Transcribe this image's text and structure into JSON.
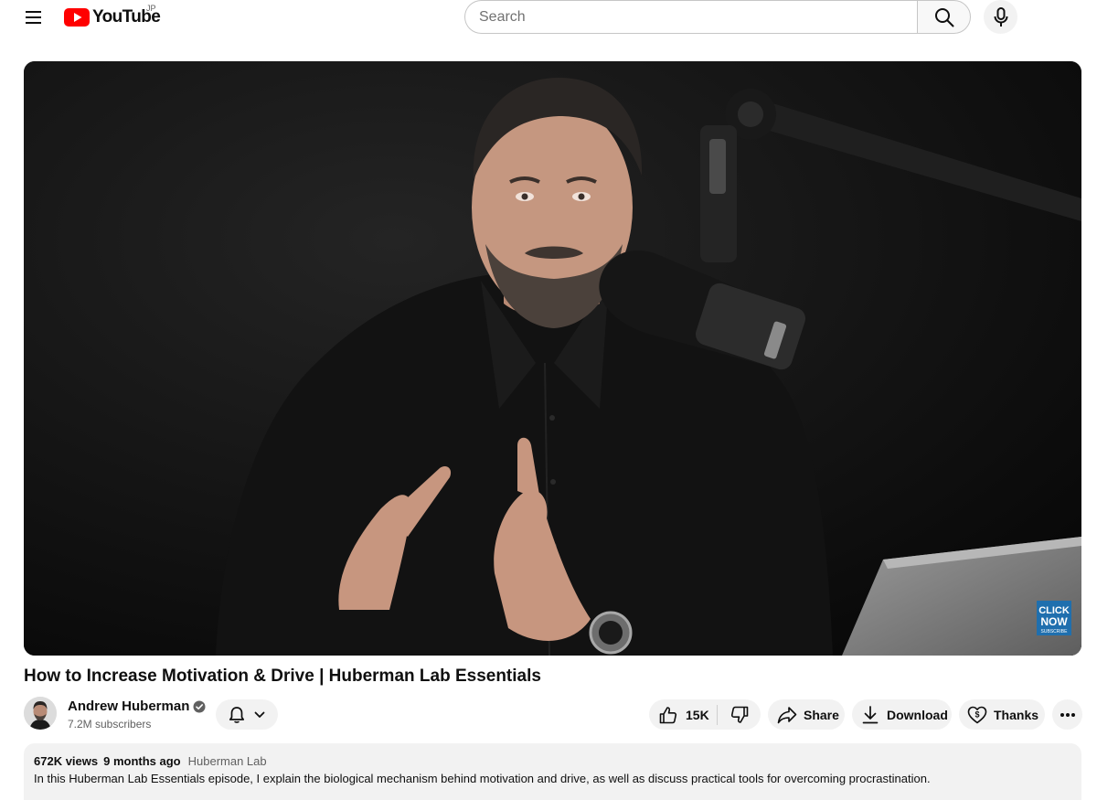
{
  "masthead": {
    "logo_text": "YouTube",
    "country_code": "JP",
    "search_placeholder": "Search",
    "icons": {
      "menu": "hamburger-icon",
      "search": "magnifier-icon",
      "voice": "microphone-icon"
    }
  },
  "player": {
    "overlay_badge": {
      "line1": "CLICK",
      "line2": "NOW",
      "line3": "SUBSCRIBE"
    }
  },
  "video": {
    "title": "How to Increase Motivation & Drive | Huberman Lab Essentials"
  },
  "channel": {
    "name": "Andrew Huberman",
    "subscribers": "7.2M subscribers",
    "verified": true
  },
  "actions": {
    "like_count": "15K",
    "share_label": "Share",
    "download_label": "Download",
    "thanks_label": "Thanks"
  },
  "description": {
    "views": "672K views",
    "date": "9 months ago",
    "tag": "Huberman Lab",
    "text": "In this Huberman Lab Essentials episode, I explain the biological mechanism behind motivation and drive, as well as discuss practical tools for overcoming procrastination."
  },
  "colors": {
    "brand_red": "#ff0000",
    "chip_bg": "#f2f2f2",
    "text_primary": "#0f0f0f",
    "text_secondary": "#606060"
  }
}
